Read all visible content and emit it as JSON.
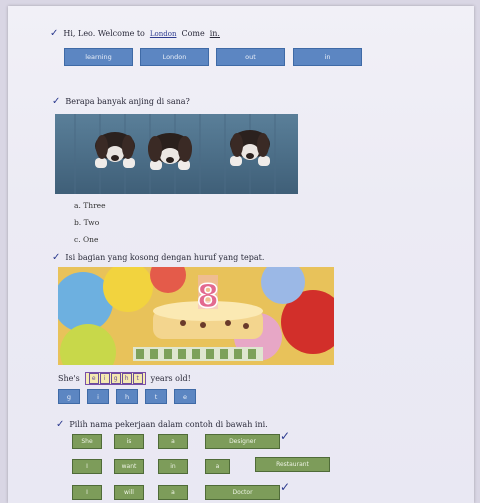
{
  "q1": {
    "check": "✓",
    "text_a": "Hi, Leo. Welcome to",
    "text_b": "Come",
    "blank1": "London",
    "blank2": "in.",
    "options": [
      "learning",
      "London",
      "out",
      "in"
    ]
  },
  "q2": {
    "check": "✓",
    "text": "Berapa banyak anjing di sana?",
    "options": [
      "a. Three",
      "b. Two",
      "c. One"
    ]
  },
  "q3": {
    "check": "✓",
    "text": "Isi bagian yang kosong dengan huruf yang tepat.",
    "sentence_start": "She's",
    "sentence_end": "years old!",
    "cake_number": "8",
    "letter_boxes": [
      "e",
      "i",
      "g",
      "h",
      "t"
    ],
    "letters": [
      "g",
      "i",
      "h",
      "t",
      "e"
    ]
  },
  "q4": {
    "check": "✓",
    "text": "Pilih nama pekerjaan dalam contoh di bawah ini.",
    "row1": [
      "She",
      "is",
      "a",
      "Designer"
    ],
    "row2": [
      "I",
      "want",
      "in",
      "a",
      "Restaurant"
    ],
    "row3": [
      "I",
      "will",
      "a",
      "Doctor"
    ]
  }
}
